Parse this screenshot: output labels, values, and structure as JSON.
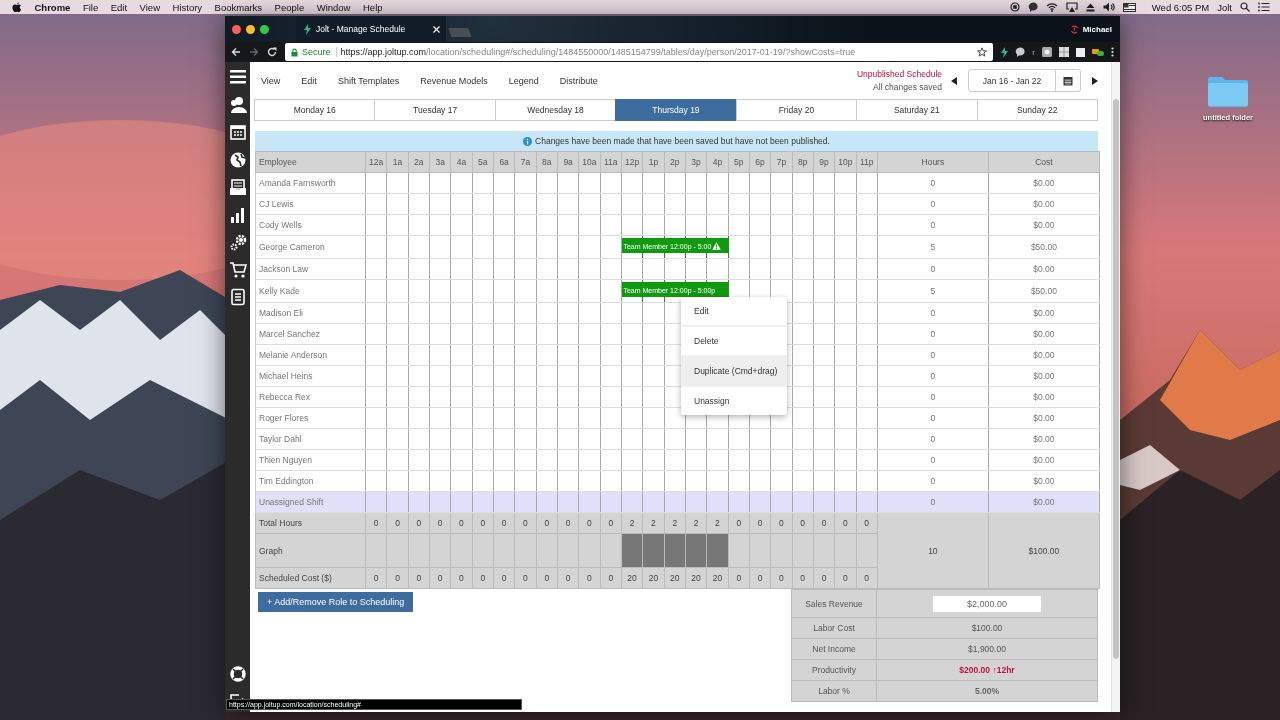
{
  "menu_bar": {
    "app": "Chrome",
    "items": [
      "File",
      "Edit",
      "View",
      "History",
      "Bookmarks",
      "People",
      "Window",
      "Help"
    ],
    "clock": "Wed 6:05 PM",
    "user": "Jolt"
  },
  "desktop": {
    "folder": "untitled folder"
  },
  "browser": {
    "tab_title": "Jolt - Manage Schedule",
    "profile": "Michael",
    "secure": "Secure",
    "url_host": "https://app.joltup.com",
    "url_path": "/location/scheduling#/scheduling/1484550000/1485154799/tables/day/person/2017-01-19/?showCosts=true",
    "extension_letter": "r",
    "status_url": "https://app.joltup.com/location/scheduling#"
  },
  "app": {
    "menu": [
      "View",
      "Edit",
      "Shift Templates",
      "Revenue Models",
      "Legend",
      "Distribute"
    ],
    "publish_status": "Unpublished Schedule",
    "save_status": "All changes saved",
    "date_range": "Jan 16 - Jan 22",
    "days": [
      {
        "label": "Monday 16",
        "selected": false
      },
      {
        "label": "Tuesday 17",
        "selected": false
      },
      {
        "label": "Wednesday 18",
        "selected": false
      },
      {
        "label": "Thursday 19",
        "selected": true
      },
      {
        "label": "Friday 20",
        "selected": false
      },
      {
        "label": "Saturday 21",
        "selected": false
      },
      {
        "label": "Sunday 22",
        "selected": false
      }
    ],
    "banner": "Changes have been made that have been saved but have not been published.",
    "grid": {
      "employee_header": "Employee",
      "hour_headers": [
        "12a",
        "1a",
        "2a",
        "3a",
        "4a",
        "5a",
        "6a",
        "7a",
        "8a",
        "9a",
        "10a",
        "11a",
        "12p",
        "1p",
        "2p",
        "3p",
        "4p",
        "5p",
        "6p",
        "7p",
        "8p",
        "9p",
        "10p",
        "11p"
      ],
      "hours_header": "Hours",
      "cost_header": "Cost",
      "rows": [
        {
          "name": "Amanda Farnsworth",
          "kind": "employee",
          "hours": "0",
          "cost": "$0.00"
        },
        {
          "name": "CJ Lewis",
          "kind": "employee",
          "hours": "0",
          "cost": "$0.00"
        },
        {
          "name": "Cody Wells",
          "kind": "employee",
          "hours": "0",
          "cost": "$0.00"
        },
        {
          "name": "George Cameron",
          "kind": "employee",
          "hours": "5",
          "cost": "$50.00",
          "shift": {
            "label": "Team Member 12:00p - 5:00",
            "slots": [
              false,
              false,
              false,
              false,
              false,
              false,
              false,
              false,
              false,
              false,
              false,
              false,
              true,
              true,
              true,
              true,
              true,
              false,
              false,
              false,
              false,
              false,
              false,
              false
            ],
            "warning": true
          }
        },
        {
          "name": "Jackson Law",
          "kind": "employee",
          "hours": "0",
          "cost": "$0.00"
        },
        {
          "name": "Kelly Kade",
          "kind": "employee",
          "hours": "5",
          "cost": "$50.00",
          "shift": {
            "label": "Team Member 12:00p - 5:00p",
            "slots": [
              false,
              false,
              false,
              false,
              false,
              false,
              false,
              false,
              false,
              false,
              false,
              false,
              true,
              true,
              true,
              true,
              true,
              false,
              false,
              false,
              false,
              false,
              false,
              false
            ],
            "warning": false
          }
        },
        {
          "name": "Madison Eli",
          "kind": "employee",
          "hours": "0",
          "cost": "$0.00"
        },
        {
          "name": "Marcel Sanchez",
          "kind": "employee",
          "hours": "0",
          "cost": "$0.00"
        },
        {
          "name": "Melanie Anderson",
          "kind": "employee",
          "hours": "0",
          "cost": "$0.00"
        },
        {
          "name": "Michael Heins",
          "kind": "employee",
          "hours": "0",
          "cost": "$0.00"
        },
        {
          "name": "Rebecca Rex",
          "kind": "employee",
          "hours": "0",
          "cost": "$0.00"
        },
        {
          "name": "Roger Flores",
          "kind": "employee",
          "hours": "0",
          "cost": "$0.00"
        },
        {
          "name": "Taylor Dahl",
          "kind": "employee",
          "hours": "0",
          "cost": "$0.00"
        },
        {
          "name": "Thien Nguyen",
          "kind": "employee",
          "hours": "0",
          "cost": "$0.00"
        },
        {
          "name": "Tim Eddington",
          "kind": "employee",
          "hours": "0",
          "cost": "$0.00"
        },
        {
          "name": "Unassigned Shift",
          "kind": "unassigned",
          "hours": "0",
          "cost": "$0.00"
        }
      ],
      "total_hours": {
        "label": "Total Hours",
        "values": [
          "0",
          "0",
          "0",
          "0",
          "0",
          "0",
          "0",
          "0",
          "0",
          "0",
          "0",
          "0",
          "2",
          "2",
          "2",
          "2",
          "2",
          "0",
          "0",
          "0",
          "0",
          "0",
          "0",
          "0"
        ]
      },
      "graph": {
        "label": "Graph",
        "filled": [
          false,
          false,
          false,
          false,
          false,
          false,
          false,
          false,
          false,
          false,
          false,
          false,
          true,
          true,
          true,
          true,
          true,
          false,
          false,
          false,
          false,
          false,
          false,
          false
        ]
      },
      "scheduled_cost": {
        "label": "Scheduled Cost ($)",
        "values": [
          "0",
          "0",
          "0",
          "0",
          "0",
          "0",
          "0",
          "0",
          "0",
          "0",
          "0",
          "0",
          "20",
          "20",
          "20",
          "20",
          "20",
          "0",
          "0",
          "0",
          "0",
          "0",
          "0",
          "0"
        ]
      },
      "total_hours_sum": "10",
      "total_cost_sum": "$100.00"
    },
    "add_role_button": "+ Add/Remove Role to Scheduling",
    "summary": [
      {
        "label": "Sales Revenue",
        "value": "$2,000.00",
        "kind": "input"
      },
      {
        "label": "Labor Cost",
        "value": "$100.00",
        "kind": "plain"
      },
      {
        "label": "Net Income",
        "value": "$1,900.00",
        "kind": "plain"
      },
      {
        "label": "Productivity",
        "value": "$200.00 ↑12hr",
        "kind": "alert"
      },
      {
        "label": "Labor %",
        "value": "5.00%",
        "kind": "bold"
      }
    ],
    "context_menu": [
      {
        "label": "Edit",
        "hovered": false
      },
      {
        "label": "Delete",
        "hovered": false
      },
      {
        "label": "Duplicate (Cmd+drag)",
        "hovered": true
      },
      {
        "label": "Unassign",
        "hovered": false
      }
    ]
  }
}
